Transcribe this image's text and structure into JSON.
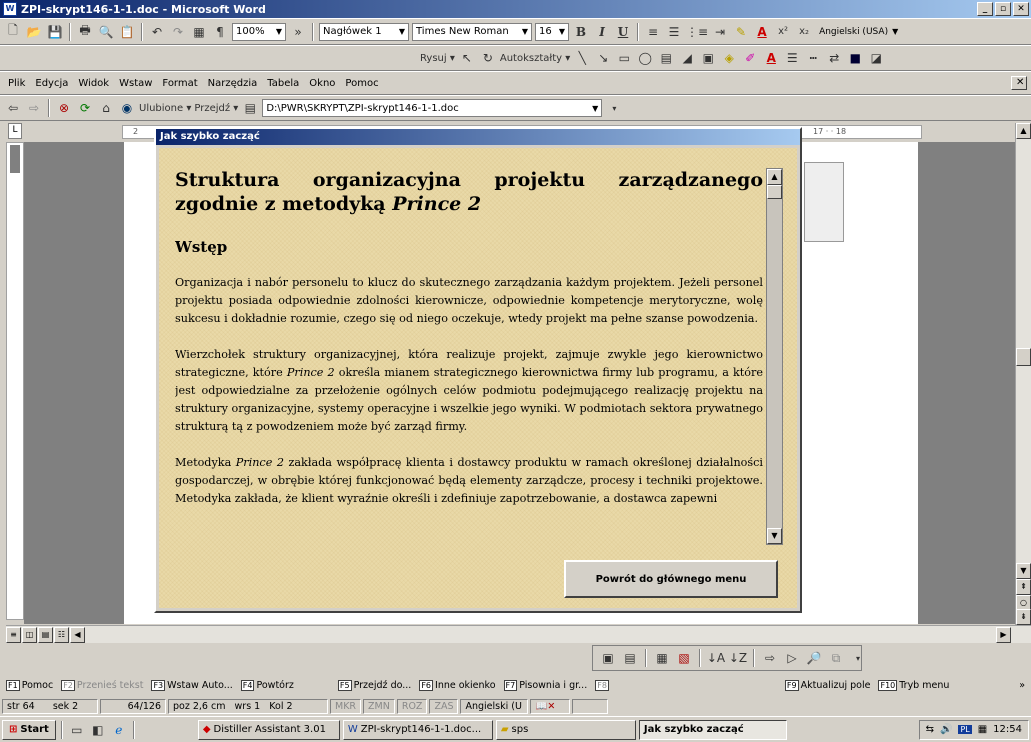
{
  "window": {
    "title": "ZPI-skrypt146-1-1.doc - Microsoft Word"
  },
  "toolbar": {
    "zoom": "100%",
    "style": "Nagłówek 1",
    "font": "Times New Roman",
    "size": "16",
    "language": "Angielski (USA)",
    "bold": "B",
    "italic": "I",
    "underline": "U",
    "pilcrow": "¶",
    "font_color_letter": "A",
    "superscript": "x²",
    "subscript": "x₂"
  },
  "drawing": {
    "draw": "Rysuj",
    "autoshapes": "Autokształty"
  },
  "menu": {
    "items": [
      "Plik",
      "Edycja",
      "Widok",
      "Wstaw",
      "Format",
      "Narzędzia",
      "Tabela",
      "Okno",
      "Pomoc"
    ]
  },
  "web": {
    "favorites": "Ulubione",
    "goto": "Przejdź",
    "address": "D:\\PWR\\SKRYPT\\ZPI-skrypt146-1-1.doc"
  },
  "ruler": {
    "left_mark": "2",
    "right_marks": "17 · · 18"
  },
  "dialog": {
    "title": "Jak szybko zacząć",
    "heading_pre": "Struktura organizacyjna projektu zarządzanego zgodnie z metodyką ",
    "heading_em": "Prince 2",
    "section": "Wstęp",
    "p1": "Organizacja i nabór personelu to klucz do skutecznego zarządzania każdym projektem. Jeżeli personel projektu posiada odpowiednie zdolności kierownicze, odpowiednie kompetencje merytoryczne, wolę sukcesu i  dokładnie rozumie, czego się od niego oczekuje, wtedy projekt ma pełne szanse powodzenia.",
    "p2a": "Wierzchołek struktury organizacyjnej, która realizuje projekt, zajmuje zwykle jego kierownictwo strategiczne, które ",
    "p2em": "Prince 2",
    "p2b": " określa mianem strategicznego kierownictwa firmy lub programu, a które jest odpowiedzialne za przełożenie ogólnych celów podmiotu podejmującego realizację projektu na struktury organizacyjne, systemy operacyjne i wszelkie jego wyniki.  W podmiotach sektora prywatnego strukturą tą z powodzeniem może być zarząd firmy.",
    "p3a": "Metodyka ",
    "p3em": "Prince 2",
    "p3b": " zakłada współpracę klienta i dostawcy produktu w ramach określonej działalności gospodarczej, w obrębie której funkcjonować będą elementy zarządcze, procesy i techniki projektowe.  Metodyka zakłada, że klient wyraźnie określi i zdefiniuje zapotrzebowanie, a dostawca zapewni",
    "back_button": "Powrót do głównego menu"
  },
  "fkeys": [
    {
      "key": "F1",
      "label": "Pomoc",
      "disabled": false
    },
    {
      "key": "F2",
      "label": "Przenieś tekst",
      "disabled": true
    },
    {
      "key": "F3",
      "label": "Wstaw Auto...",
      "disabled": false
    },
    {
      "key": "F4",
      "label": "Powtórz",
      "disabled": false
    },
    {
      "key": "F5",
      "label": "Przejdź do...",
      "disabled": false
    },
    {
      "key": "F6",
      "label": "Inne okienko",
      "disabled": false
    },
    {
      "key": "F7",
      "label": "Pisownia i gr...",
      "disabled": false
    },
    {
      "key": "F8",
      "label": "",
      "disabled": true
    },
    {
      "key": "F9",
      "label": "Aktualizuj pole",
      "disabled": false
    },
    {
      "key": "F10",
      "label": "Tryb menu",
      "disabled": false
    }
  ],
  "status": {
    "page": "str 64",
    "section": "sek 2",
    "pages": "64/126",
    "pos": "poz 2,6 cm",
    "line": "wrs 1",
    "col": "Kol 2",
    "rec": "MKR",
    "trk": "ZMN",
    "ext": "ROZ",
    "ovr": "ZAS",
    "lang": "Angielski (U"
  },
  "taskbar": {
    "start": "Start",
    "tasks": [
      "Distiller Assistant 3.01",
      "ZPI-skrypt146-1-1.doc...",
      "sps",
      "Jak szybko zacząć"
    ],
    "clock": "12:54"
  }
}
